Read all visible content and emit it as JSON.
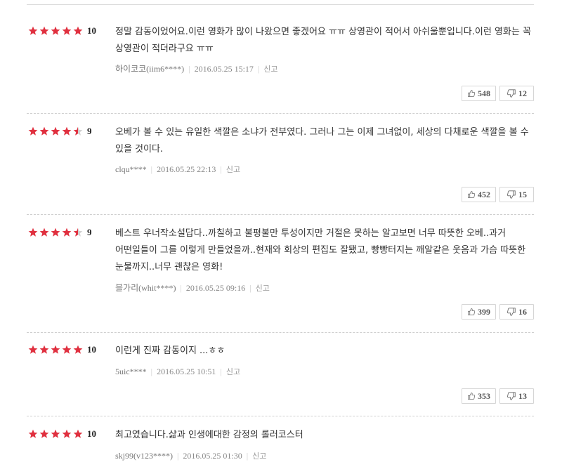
{
  "colors": {
    "star": "#e0303f",
    "star_empty": "#d0d0d0"
  },
  "reviews": [
    {
      "rating_stars": 5,
      "score": "10",
      "text": "정말 감동이었어요.이런 영화가 많이 나왔으면 좋겠어요 ㅠㅠ 상영관이 적어서 아쉬울뿐입니다.이런 영화는 꼭 상영관이 적더라구요 ㅠㅠ",
      "author": "하이코코(iim6****)",
      "date": "2016.05.25 15:17",
      "report": "신고",
      "likes": "548",
      "dislikes": "12"
    },
    {
      "rating_stars": 4.5,
      "score": "9",
      "text": "오베가 볼 수 있는 유일한 색깔은 소냐가 전부였다. 그러나 그는 이제 그녀없이, 세상의 다채로운 색깔을 볼 수 있을 것이다.",
      "author": "clqu****",
      "date": "2016.05.25 22:13",
      "report": "신고",
      "likes": "452",
      "dislikes": "15"
    },
    {
      "rating_stars": 4.5,
      "score": "9",
      "text": "베스트 우너작소설답다..까칠하고 불평불만 투성이지만 거절은 못하는 알고보면 너무 따뜻한 오베..과거 어떤일들이 그를 이렇게 만들었을까..현재와 회상의 편집도 잘됐고, 빵빵터지는 깨알같은 웃음과 가슴 따뜻한 눈물까지..너무 괜찮은 영화!",
      "author": "블가리(whit****)",
      "date": "2016.05.25 09:16",
      "report": "신고",
      "likes": "399",
      "dislikes": "16"
    },
    {
      "rating_stars": 5,
      "score": "10",
      "text": "이런게 진짜 감동이지 ...ㅎㅎ",
      "author": "5uic****",
      "date": "2016.05.25 10:51",
      "report": "신고",
      "likes": "353",
      "dislikes": "13"
    },
    {
      "rating_stars": 5,
      "score": "10",
      "text": "최고였습니다.삶과 인생에대한 감정의 롤러코스터",
      "author": "skj99(v123****)",
      "date": "2016.05.25 01:30",
      "report": "신고"
    }
  ]
}
